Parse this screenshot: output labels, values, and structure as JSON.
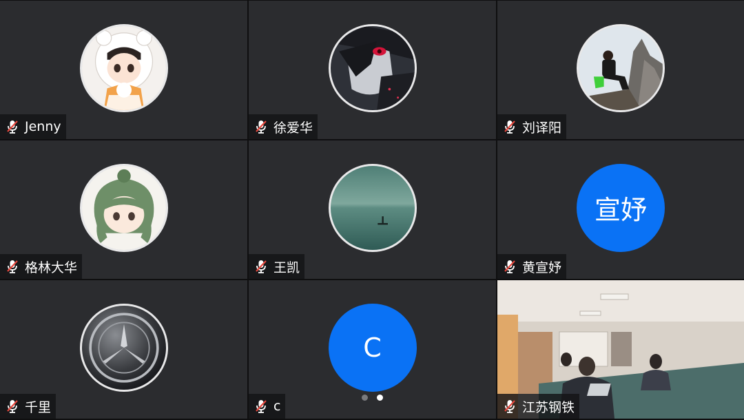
{
  "participants": [
    {
      "name": "Jenny",
      "avatar": "anime-girl-bear-hood-icon"
    },
    {
      "name": "徐爱华",
      "avatar": "dark-anime-character-icon"
    },
    {
      "name": "刘译阳",
      "avatar": "man-sitting-on-rock-photo-icon"
    },
    {
      "name": "格林大华",
      "avatar": "anime-green-hair-girl-icon"
    },
    {
      "name": "王凯",
      "avatar": "boat-on-lake-photo-icon"
    },
    {
      "name": "黄宣妤",
      "avatar_text": "宣妤"
    },
    {
      "name": "千里",
      "avatar": "mercedes-logo-icon"
    },
    {
      "name": "c",
      "avatar_text": "C"
    },
    {
      "name": "江苏钢铁",
      "video": "meeting-room-camera-feed"
    }
  ],
  "pagination": {
    "pages": 2,
    "current": 2
  },
  "colors": {
    "tile_bg": "#2b2c2f",
    "accent_blue": "#0a72f5",
    "mic_muted": "#e8463c"
  }
}
